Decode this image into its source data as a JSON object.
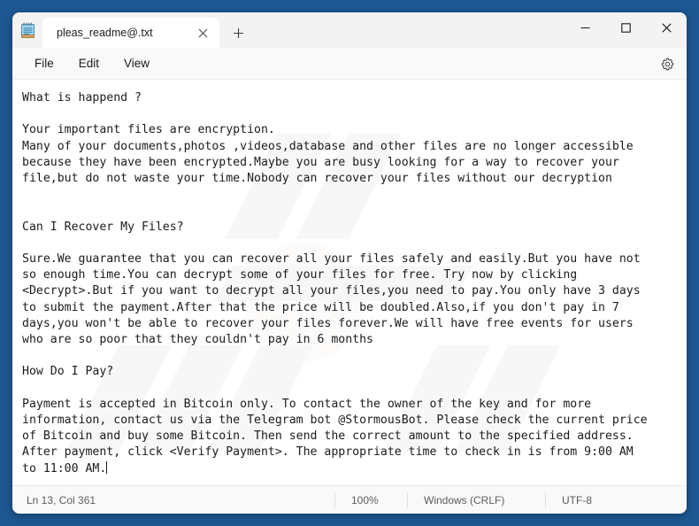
{
  "window": {
    "app_icon": "notepad-icon",
    "controls": {
      "minimize": "minimize-icon",
      "maximize": "maximize-icon",
      "close": "close-icon"
    }
  },
  "tabs": [
    {
      "title": "pleas_readme@.txt",
      "close_label": "close-tab-icon",
      "active": true
    }
  ],
  "new_tab_label": "new-tab-icon",
  "menu": {
    "items": [
      "File",
      "Edit",
      "View"
    ],
    "settings_label": "gear-icon"
  },
  "editor": {
    "content": "What is happend ?\n\nYour important files are encryption.\nMany of your documents,photos ,videos,database and other files are no longer accessible\nbecause they have been encrypted.Maybe you are busy looking for a way to recover your\nfile,but do not waste your time.Nobody can recover your files without our decryption\n\n\nCan I Recover My Files?\n\nSure.We guarantee that you can recover all your files safely and easily.But you have not\nso enough time.You can decrypt some of your files for free. Try now by clicking\n<Decrypt>.But if you want to decrypt all your files,you need to pay.You only have 3 days\nto submit the payment.After that the price will be doubled.Also,if you don't pay in 7\ndays,you won't be able to recover your files forever.We will have free events for users\nwho are so poor that they couldn't pay in 6 months\n\nHow Do I Pay?\n\nPayment is accepted in Bitcoin only. To contact the owner of the key and for more\ninformation, contact us via the Telegram bot @StormousBot. Please check the current price\nof Bitcoin and buy some Bitcoin. Then send the correct amount to the specified address.\nAfter payment, click <Verify Payment>. The appropriate time to check in is from 9:00 AM\nto 11:00 AM."
  },
  "statusbar": {
    "position": "Ln 13, Col 361",
    "zoom": "100%",
    "line_ending": "Windows (CRLF)",
    "encoding": "UTF-8"
  },
  "colors": {
    "desktop": "#1e5893",
    "window_chrome": "#f3f3f3",
    "editor_bg": "#ffffff",
    "text": "#1b1b1b",
    "status_text": "#5d5d5d",
    "close_hover": "#c42b1c"
  }
}
